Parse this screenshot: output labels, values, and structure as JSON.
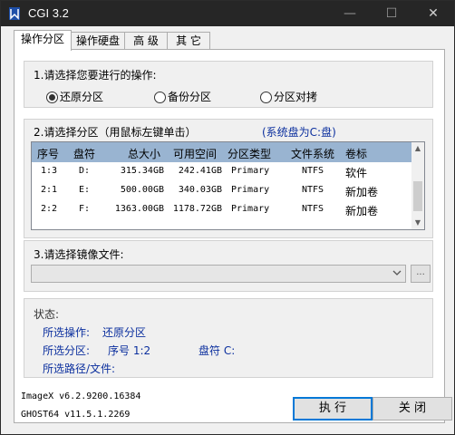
{
  "window": {
    "title": "CGI 3.2",
    "minimize": "—",
    "maximize": "☐",
    "close": "✕"
  },
  "tabs": [
    {
      "label": "操作分区",
      "active": true
    },
    {
      "label": "操作硬盘",
      "active": false
    },
    {
      "label": "高 级",
      "active": false
    },
    {
      "label": "其 它",
      "active": false
    }
  ],
  "operation": {
    "label": "1.请选择您要进行的操作:",
    "options": [
      {
        "label": "还原分区",
        "selected": true
      },
      {
        "label": "备份分区",
        "selected": false
      },
      {
        "label": "分区对拷",
        "selected": false
      }
    ]
  },
  "partition": {
    "label": "2.请选择分区（用鼠标左键单击）",
    "system_disk": "(系统盘为C:盘)",
    "columns": [
      "序号",
      "盘符",
      "总大小",
      "可用空间",
      "分区类型",
      "文件系统",
      "卷标"
    ],
    "rows": [
      [
        "1:3",
        "D:",
        "315.34GB",
        "242.41GB",
        "Primary",
        "NTFS",
        "软件"
      ],
      [
        "2:1",
        "E:",
        "500.00GB",
        "340.03GB",
        "Primary",
        "NTFS",
        "新加卷"
      ],
      [
        "2:2",
        "F:",
        "1363.00GB",
        "1178.72GB",
        "Primary",
        "NTFS",
        "新加卷"
      ]
    ]
  },
  "image_file": {
    "label": "3.请选择镜像文件:",
    "value": "",
    "browse": "..."
  },
  "status": {
    "label": "状态:",
    "operation_key": "所选操作:",
    "operation_val": "还原分区",
    "partition_key": "所选分区:",
    "partition_num": "序号 1:2",
    "partition_drive": "盘符 C:",
    "path_key": "所选路径/文件:"
  },
  "versions": {
    "imagex": "ImageX v6.2.9200.16384",
    "ghost": "GHOST64 v11.5.1.2269"
  },
  "buttons": {
    "execute": "执 行",
    "close": "关 闭"
  },
  "colors": {
    "titlebar": "#262626",
    "header": "#99b4d1",
    "status_text": "#0b2f9e",
    "accent": "#0078d7"
  }
}
